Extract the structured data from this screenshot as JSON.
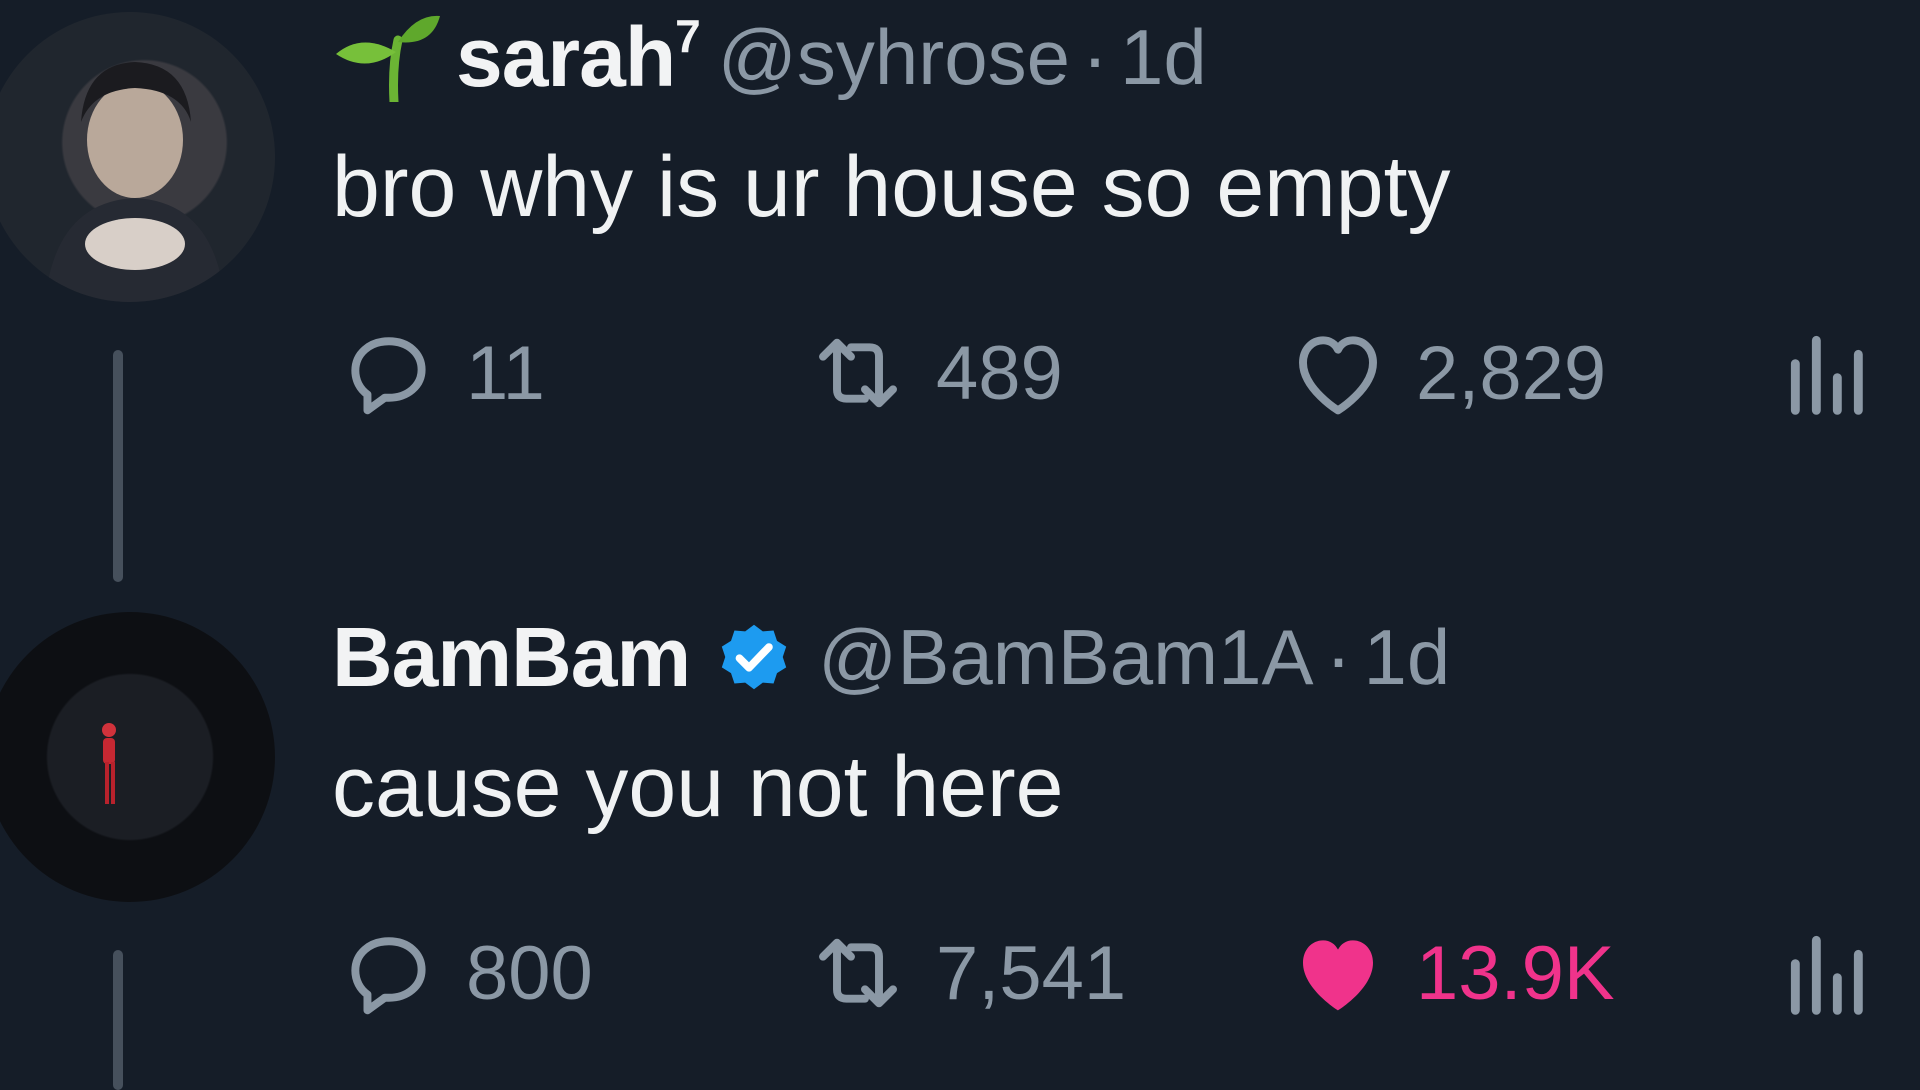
{
  "tweets": [
    {
      "display_name": "sarah",
      "name_superscript": "7",
      "name_prefix_icon": "seedling-icon",
      "handle": "@syhrose",
      "separator": "·",
      "time": "1d",
      "text": "bro why is ur house so empty",
      "replies": "11",
      "retweets": "489",
      "likes": "2,829",
      "liked": false
    },
    {
      "display_name": "BamBam",
      "verified": true,
      "handle": "@BamBam1A",
      "separator": "·",
      "time": "1d",
      "text": "cause you not here",
      "replies": "800",
      "retweets": "7,541",
      "likes": "13.9K",
      "liked": true
    }
  ],
  "colors": {
    "background": "#151d28",
    "muted": "#8b98a5",
    "like_active": "#f0338b",
    "verified_blue": "#1d9bf0"
  }
}
